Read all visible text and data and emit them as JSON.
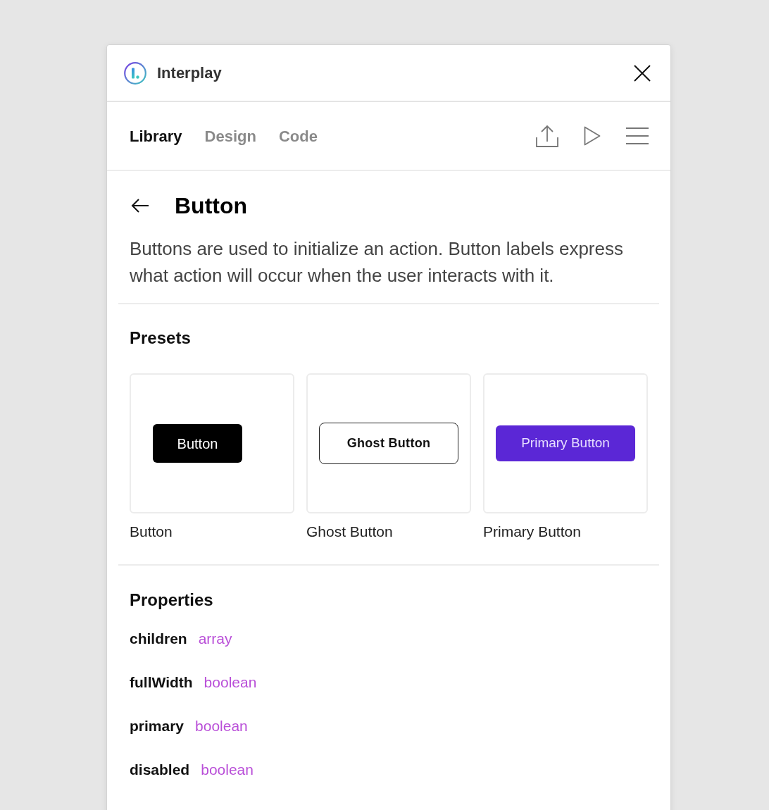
{
  "app": {
    "title": "Interplay"
  },
  "tabs": [
    {
      "label": "Library",
      "selected": true
    },
    {
      "label": "Design",
      "selected": false
    },
    {
      "label": "Code",
      "selected": false
    }
  ],
  "page": {
    "title": "Button",
    "description": "Buttons are used to initialize an action. Button labels express what action will occur when the user interacts with it."
  },
  "presets": {
    "title": "Presets",
    "items": [
      {
        "kind": "solid",
        "button_label": "Button",
        "caption": "Button"
      },
      {
        "kind": "ghost",
        "button_label": "Ghost Button",
        "caption": "Ghost Button"
      },
      {
        "kind": "primary",
        "button_label": "Primary Button",
        "caption": "Primary Button"
      }
    ]
  },
  "properties": {
    "title": "Properties",
    "items": [
      {
        "name": "children",
        "type": "array"
      },
      {
        "name": "fullWidth",
        "type": "boolean"
      },
      {
        "name": "primary",
        "type": "boolean"
      },
      {
        "name": "disabled",
        "type": "boolean"
      }
    ]
  }
}
